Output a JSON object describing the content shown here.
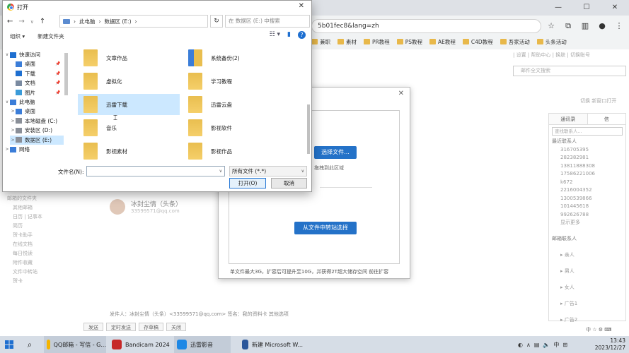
{
  "dialog": {
    "title": "打开",
    "close_icon": "✕",
    "nav": {
      "back": "←",
      "forward": "→",
      "recent": "∨",
      "up": "↑"
    },
    "path": [
      "此电脑",
      "数据区 (E:)"
    ],
    "search_placeholder": "在 数据区 (E:) 中搜索",
    "organize": "组织 ▾",
    "new_folder": "新建文件夹",
    "tree": [
      {
        "label": "快速访问",
        "icon": "star-icon",
        "arrow": "∨",
        "pinned": false
      },
      {
        "label": "桌面",
        "icon": "desktop-icon",
        "arrow": "",
        "pinned": true
      },
      {
        "label": "下载",
        "icon": "download-icon",
        "arrow": "",
        "pinned": true
      },
      {
        "label": "文档",
        "icon": "document-icon",
        "arrow": "",
        "pinned": true
      },
      {
        "label": "图片",
        "icon": "picture-icon",
        "arrow": "",
        "pinned": true
      },
      {
        "label": "此电脑",
        "icon": "computer-icon",
        "arrow": "∨",
        "pinned": false
      },
      {
        "label": "桌面",
        "icon": "desktop-icon",
        "arrow": ">",
        "pinned": false
      },
      {
        "label": "本地磁盘 (C:)",
        "icon": "drive-icon",
        "arrow": ">",
        "pinned": false
      },
      {
        "label": "安装区 (D:)",
        "icon": "drive-icon",
        "arrow": ">",
        "pinned": false
      },
      {
        "label": "数据区 (E:)",
        "icon": "drive-icon",
        "arrow": ">",
        "pinned": false,
        "selected": true
      },
      {
        "label": "网络",
        "icon": "network-icon",
        "arrow": ">",
        "pinned": false
      }
    ],
    "files": [
      {
        "name": "文章作品",
        "icon": "folder-icon"
      },
      {
        "name": "系统备份(2)",
        "icon": "archive-folder-icon"
      },
      {
        "name": "虚拟化",
        "icon": "folder-icon"
      },
      {
        "name": "学习教程",
        "icon": "folder-icon"
      },
      {
        "name": "迅雷下载",
        "icon": "folder-icon",
        "selected": true
      },
      {
        "name": "迅雷云盘",
        "icon": "folder-icon"
      },
      {
        "name": "音乐",
        "icon": "folder-icon"
      },
      {
        "name": "影视软件",
        "icon": "folder-icon"
      },
      {
        "name": "影视素材",
        "icon": "folder-icon"
      },
      {
        "name": "影视作品",
        "icon": "folder-icon"
      }
    ],
    "filename_label": "文件名(N):",
    "filename_value": "",
    "filter": "所有文件 (*.*)",
    "open_button": "打开(O)",
    "cancel_button": "取消"
  },
  "browser": {
    "address": "5b01fec8&lang=zh",
    "bookmarks": [
      "兼职",
      "素材",
      "PR教程",
      "PS教程",
      "AE教程",
      "C4D教程",
      "吾家活动",
      "头条活动"
    ],
    "window_controls": [
      "—",
      "☐",
      "✕"
    ]
  },
  "mail": {
    "top_info": "| 设置 | 帮助中心 | 换肤 | 切换账号",
    "search_placeholder": "邮件全文搜索",
    "top_links": "切换 新窗口打开",
    "left_menu": [
      "邮箱的文件夹",
      "其他邮箱",
      "日历 | 记事本",
      "简历",
      "贺卡助手",
      "在线文档",
      "每日悦读",
      "附件收藏",
      "文件中转站",
      "贺卡"
    ],
    "contact_name": "冰封尘情（头条）",
    "contact_email": "33599571@qq.com",
    "right_tabs": [
      "通讯录",
      "信"
    ],
    "right_search": "查找联系人...",
    "right_list": [
      {
        "text": "最近联系人",
        "header": true
      },
      {
        "text": "316705395"
      },
      {
        "text": "282382981"
      },
      {
        "text": "13811888308"
      },
      {
        "text": "17586221006"
      },
      {
        "text": "k672"
      },
      {
        "text": "2216004352"
      },
      {
        "text": "1300539866"
      },
      {
        "text": "101445618"
      },
      {
        "text": "992626788"
      },
      {
        "text": "显示更多"
      },
      {
        "text": "",
        "header": true
      },
      {
        "text": "邮箱联系人",
        "header": true
      },
      {
        "text": "",
        "header": true
      },
      {
        "text": "▸ 亲人"
      },
      {
        "text": "",
        "header": true
      },
      {
        "text": "▸ 男人"
      },
      {
        "text": "",
        "header": true
      },
      {
        "text": "▸ 女人"
      },
      {
        "text": "",
        "header": true
      },
      {
        "text": "▸ 广告1"
      },
      {
        "text": "",
        "header": true
      },
      {
        "text": "▸ 广告2"
      }
    ],
    "sender": "发件人：冰封尘情（头条）<33599571@qq.com>  签名：我的资料卡  其他选项",
    "bottom_tabs": [
      "发送",
      "定时发送",
      "存草稿",
      "关闭"
    ]
  },
  "upload": {
    "button_local": "选择文件...",
    "hint": "拖拽到此区域",
    "button_station": "从文件中转站选择",
    "footer": "单文件最大3G，扩容后可提升至10G，并获得2T超大储存空间   前往扩容"
  },
  "taskbar": {
    "items": [
      {
        "label": "QQ邮箱 - 写信 - G...",
        "color": "#f4b400",
        "active": true
      },
      {
        "label": "Bandicam 2024",
        "color": "#c62828",
        "active": false
      },
      {
        "label": "迅雷影音",
        "color": "#1e88e5",
        "active": true
      },
      {
        "label": "新建 Microsoft W...",
        "color": "#2b579a",
        "active": false
      }
    ],
    "time": "13:43",
    "date": "2023/12/27"
  }
}
